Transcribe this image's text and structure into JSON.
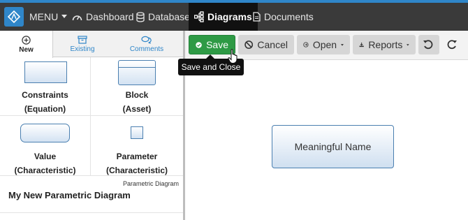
{
  "nav": {
    "menu": "MENU",
    "dashboard": "Dashboard",
    "database": "Database",
    "diagrams": "Diagrams",
    "documents": "Documents"
  },
  "tabs": {
    "new": "New",
    "existing": "Existing",
    "comments": "Comments"
  },
  "palette": {
    "constraints": {
      "name": "Constraints",
      "kind": "(Equation)"
    },
    "block": {
      "name": "Block",
      "kind": "(Asset)"
    },
    "value": {
      "name": "Value",
      "kind": "(Characteristic)"
    },
    "parameter": {
      "name": "Parameter",
      "kind": "(Characteristic)"
    }
  },
  "diagram": {
    "type_label": "Parametric Diagram",
    "name": "My New Parametric Diagram"
  },
  "toolbar": {
    "save": "Save",
    "cancel": "Cancel",
    "open": "Open",
    "reports": "Reports",
    "save_tooltip": "Save and Close"
  },
  "canvas": {
    "node_label": "Meaningful Name"
  },
  "colors": {
    "accent": "#2f86c9",
    "save_green": "#2e9a45",
    "nav_bg": "#3a3a3a"
  }
}
